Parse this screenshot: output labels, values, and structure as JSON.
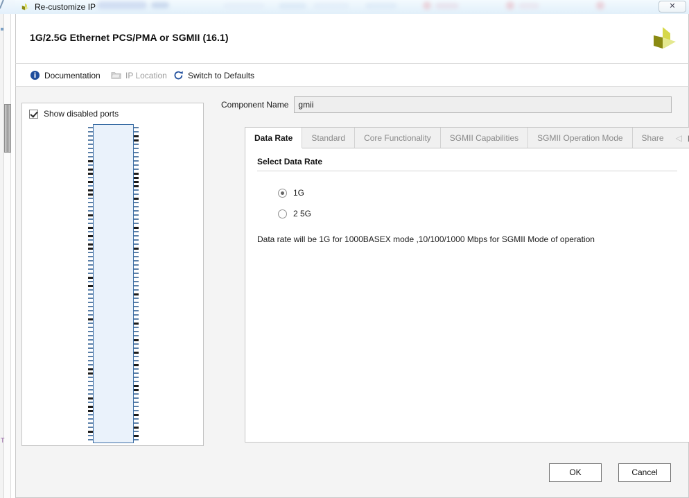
{
  "titlebar": {
    "title": "Re-customize IP",
    "icon": "xilinx-logo-icon",
    "close_label": "✕"
  },
  "header": {
    "title": "1G/2.5G Ethernet PCS/PMA or SGMII (16.1)",
    "logo": "xilinx-logo-icon"
  },
  "toolbar": {
    "items": [
      {
        "label": "Documentation",
        "icon": "info-icon",
        "disabled": false
      },
      {
        "label": "IP Location",
        "icon": "folder-icon",
        "disabled": true
      },
      {
        "label": "Switch to Defaults",
        "icon": "refresh-icon",
        "disabled": false
      }
    ]
  },
  "ip_panel": {
    "show_disabled_ports": {
      "label": "Show disabled ports",
      "checked": true
    },
    "symbol": {
      "name": "ip-block-symbol",
      "fill_color": "#eaf2fb",
      "border_color": "#3b6ea5"
    }
  },
  "component_name": {
    "label": "Component Name",
    "value": "gmii",
    "placeholder": "gmii"
  },
  "tabs": {
    "items": [
      {
        "label": "Data Rate",
        "active": true
      },
      {
        "label": "Standard",
        "active": false
      },
      {
        "label": "Core Functionality",
        "active": false
      },
      {
        "label": "SGMII Capabilities",
        "active": false
      },
      {
        "label": "SGMII Operation Mode",
        "active": false
      },
      {
        "label": "Share",
        "active": false
      }
    ],
    "nav": {
      "prev": "◁",
      "next": "▶",
      "menu": "☰"
    }
  },
  "data_rate_page": {
    "section_title": "Select Data Rate",
    "options": [
      {
        "label": "1G",
        "selected": true
      },
      {
        "label": "2 5G",
        "selected": false
      }
    ],
    "description": "Data rate will be 1G for 1000BASEX mode ,10/100/1000 Mbps for SGMII Mode of operation"
  },
  "footer": {
    "ok_label": "OK",
    "cancel_label": "Cancel"
  },
  "colors": {
    "accent_blue": "#3b6ea5",
    "logo_yellow": "#d6d84a",
    "logo_olive": "#8a8a12",
    "titlebar": "#e9f4fc"
  }
}
